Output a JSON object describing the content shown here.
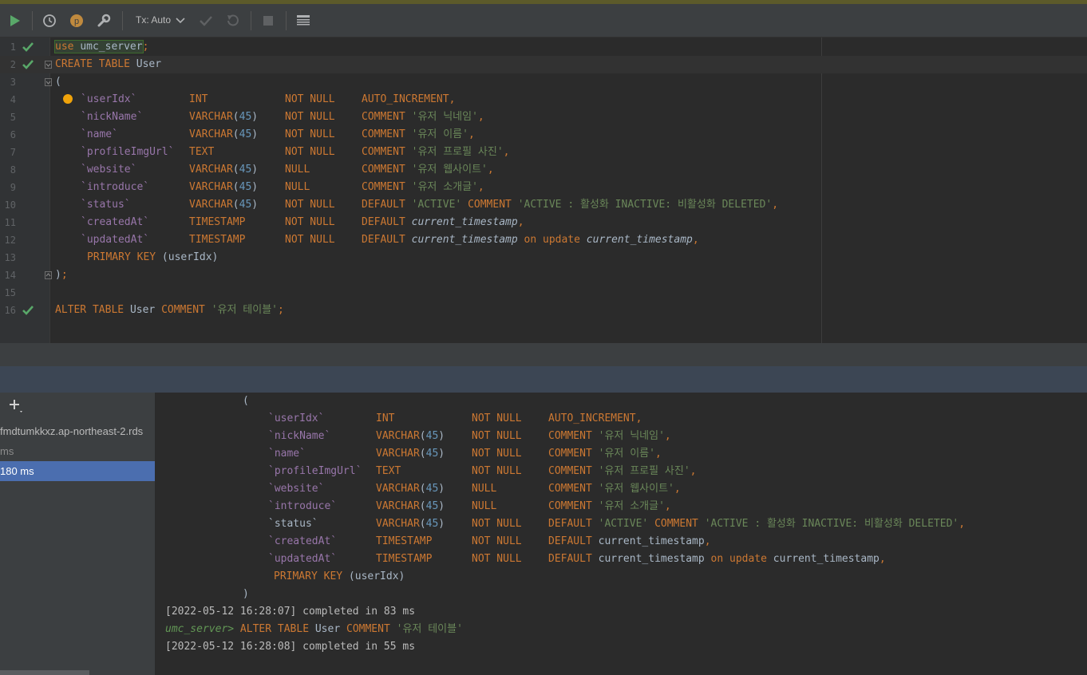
{
  "toolbar": {
    "tx_label": "Tx: Auto",
    "icons": [
      "run-icon",
      "history-icon",
      "profile-p-icon",
      "wrench-icon",
      "commit-check-icon",
      "rollback-icon",
      "stop-icon",
      "table-view-icon"
    ]
  },
  "editor": {
    "lines": [
      {
        "n": "1"
      },
      {
        "n": "2"
      },
      {
        "n": "3"
      },
      {
        "n": "4"
      },
      {
        "n": "5"
      },
      {
        "n": "6"
      },
      {
        "n": "7"
      },
      {
        "n": "8"
      },
      {
        "n": "9"
      },
      {
        "n": "10"
      },
      {
        "n": "11"
      },
      {
        "n": "12"
      },
      {
        "n": "13"
      },
      {
        "n": "14"
      },
      {
        "n": "15"
      },
      {
        "n": "16"
      }
    ],
    "tokens": {
      "use": "use",
      "umc": "umc_server",
      "create": "CREATE",
      "table": "TABLE",
      "user": "User",
      "c_userIdx": "`userIdx`",
      "c_nickName": "`nickName`",
      "c_name": "`name`",
      "c_profile": "`profileImgUrl`",
      "c_website": "`website`",
      "c_introduce": "`introduce`",
      "c_status": "`status`",
      "c_created": "`createdAt`",
      "c_updated": "`updatedAt`",
      "int": "INT",
      "varchar": "VARCHAR",
      "n45": "45",
      "text": "TEXT",
      "timestamp": "TIMESTAMP",
      "notnull": "NOT NULL",
      "null": "NULL",
      "auto": "AUTO_INCREMENT",
      "comment": "COMMENT",
      "default": "DEFAULT",
      "s_nick": "'유저 닉네임'",
      "s_name": "'유저 이름'",
      "s_profile": "'유저 프로필 사진'",
      "s_website": "'유저 웹사이트'",
      "s_intro": "'유저 소개글'",
      "s_active": "'ACTIVE'",
      "s_status": "'ACTIVE : 활성화 INACTIVE: 비활성화 DELETED'",
      "curts": "current_timestamp",
      "on": "on",
      "update": "update",
      "pk": "PRIMARY KEY",
      "pk_col": "(userIdx)",
      "alter": "ALTER",
      "s_table": "'유저 테이블'"
    }
  },
  "sessions": [
    {
      "label": "fmdtumkkxz.ap-northeast-2.rds",
      "selected": false
    },
    {
      "label": " ms",
      "selected": false
    },
    {
      "label": "180 ms",
      "selected": true
    }
  ],
  "console": {
    "log1": "[2022-05-12 16:28:07] completed in 83 ms",
    "prompt": "umc_server>",
    "alter_stmt": "ALTER TABLE User COMMENT ",
    "log2": "[2022-05-12 16:28:08] completed in 55 ms",
    "close_paren": ")"
  },
  "colors": {
    "keyword": "#cc7832",
    "column": "#9876aa",
    "string": "#6a8759",
    "number": "#6897bb",
    "selection": "#4b6eaf"
  }
}
